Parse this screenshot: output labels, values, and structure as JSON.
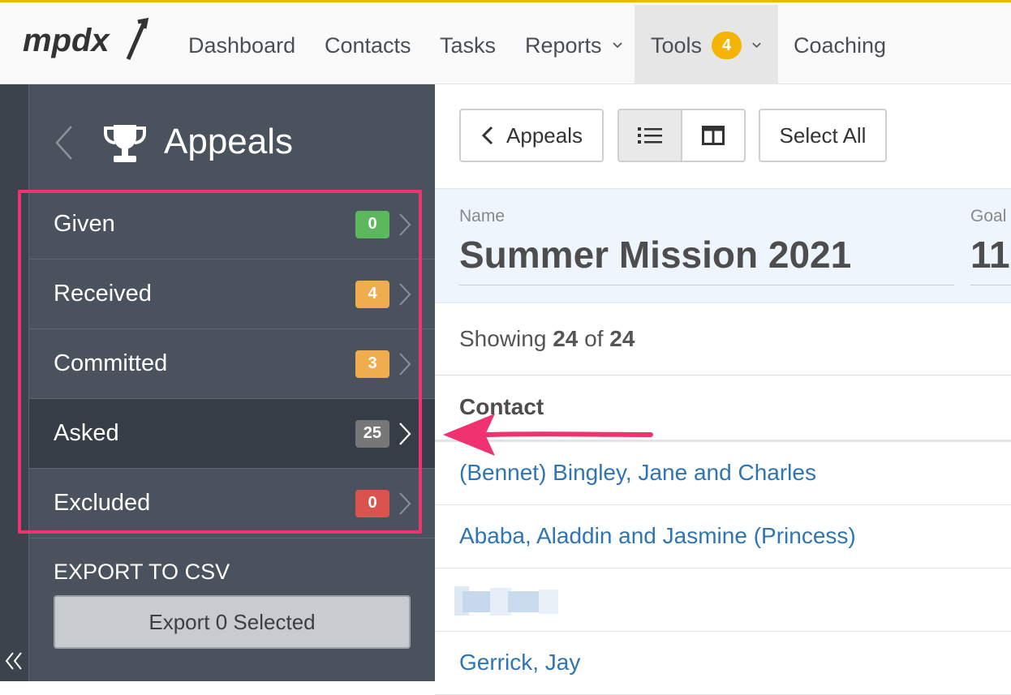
{
  "nav": {
    "logo_text": "mpdx",
    "items": [
      {
        "label": "Dashboard"
      },
      {
        "label": "Contacts"
      },
      {
        "label": "Tasks"
      },
      {
        "label": "Reports"
      },
      {
        "label": "Tools",
        "badge": "4"
      },
      {
        "label": "Coaching"
      }
    ]
  },
  "sidebar": {
    "title": "Appeals",
    "statuses": [
      {
        "label": "Given",
        "count": "0",
        "color": "#5cb85c"
      },
      {
        "label": "Received",
        "count": "4",
        "color": "#f0ad4e"
      },
      {
        "label": "Committed",
        "count": "3",
        "color": "#f0ad4e"
      },
      {
        "label": "Asked",
        "count": "25",
        "color": "#777777"
      },
      {
        "label": "Excluded",
        "count": "0",
        "color": "#d9534f"
      }
    ],
    "export_title": "EXPORT TO CSV",
    "export_button": "Export 0 Selected"
  },
  "toolbar": {
    "back_label": "Appeals",
    "select_all_label": "Select All"
  },
  "appeal": {
    "name_label": "Name",
    "name_value": "Summer Mission 2021",
    "goal_label": "Goal",
    "goal_value": "11"
  },
  "list": {
    "showing_prefix": "Showing",
    "shown": "24",
    "of_word": "of",
    "total": "24",
    "column_header": "Contact",
    "contacts": [
      {
        "name": "(Bennet) Bingley, Jane and Charles"
      },
      {
        "name": "Ababa, Aladdin and Jasmine (Princess)"
      },
      {
        "name": ""
      },
      {
        "name": "Gerrick, Jay"
      }
    ]
  },
  "colors": {
    "accent": "#f4b400",
    "highlight": "#f0326e",
    "link": "#2e75b5",
    "sidebar_bg": "#4a535d"
  }
}
